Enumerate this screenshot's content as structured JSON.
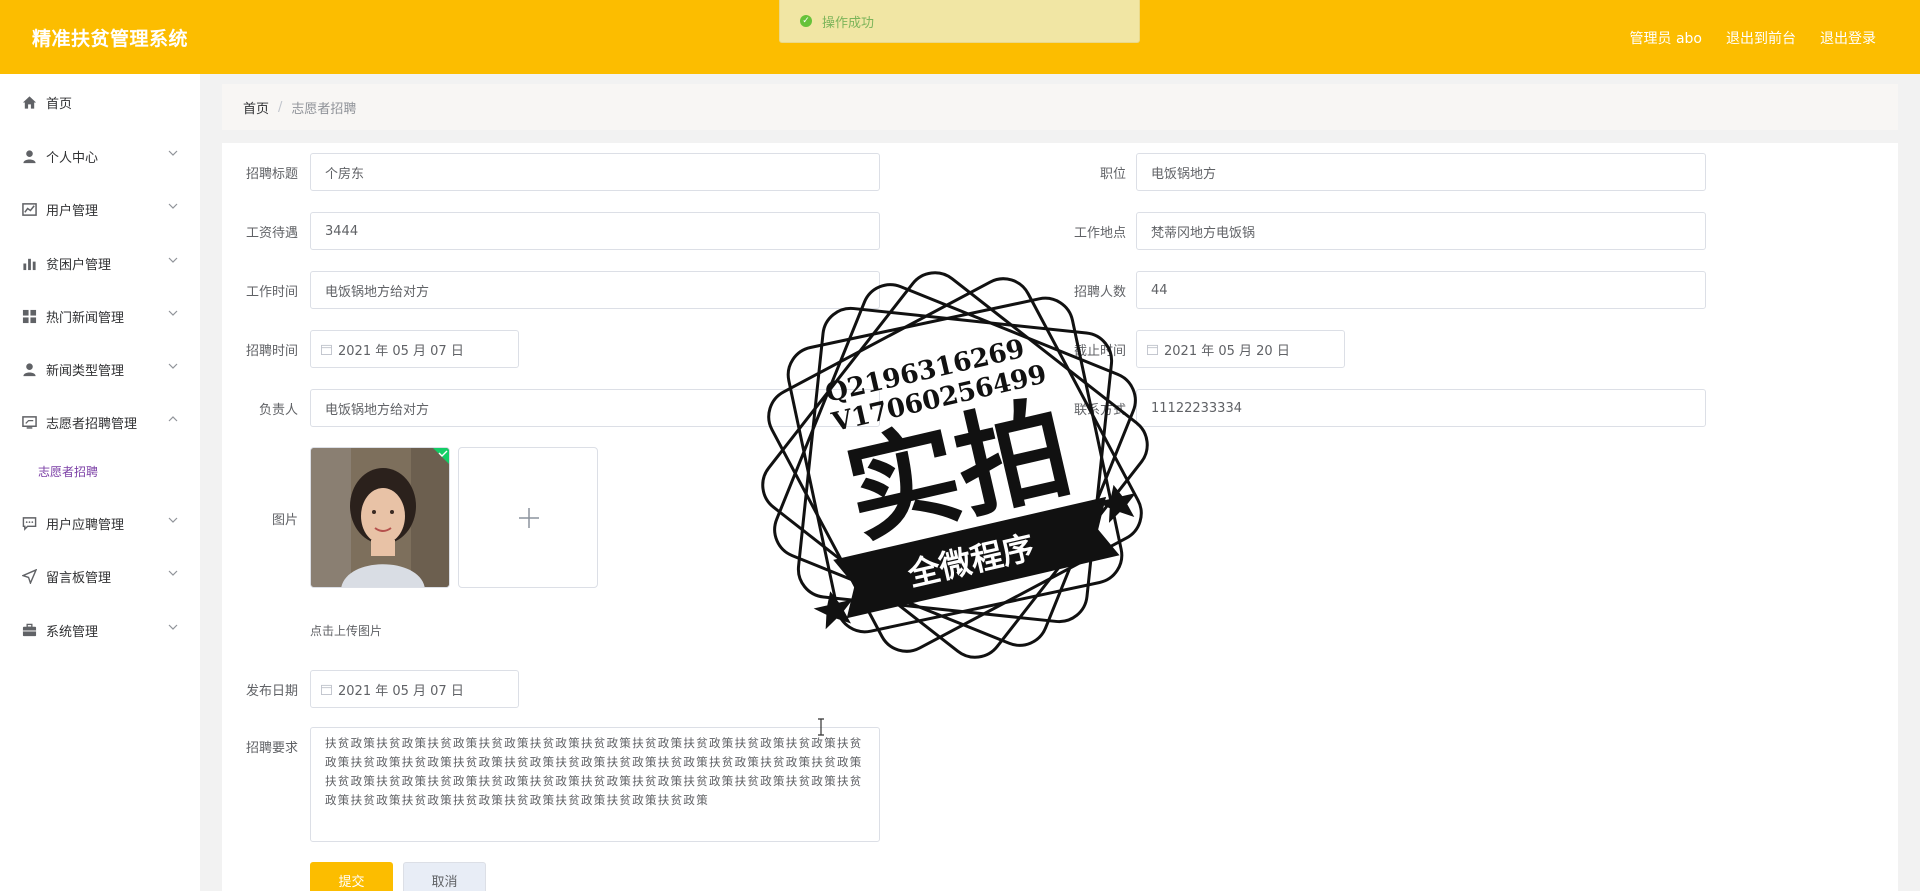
{
  "app": {
    "title": "精准扶贫管理系统"
  },
  "header": {
    "links": [
      "管理员 abo",
      "退出到前台",
      "退出登录"
    ]
  },
  "toast": {
    "text": "操作成功"
  },
  "sidebar": {
    "items": [
      {
        "label": "首页",
        "icon": "home-icon"
      },
      {
        "label": "个人中心",
        "icon": "user-icon"
      },
      {
        "label": "用户管理",
        "icon": "chart-icon"
      },
      {
        "label": "贫困户管理",
        "icon": "bar-chart-icon"
      },
      {
        "label": "热门新闻管理",
        "icon": "grid-icon"
      },
      {
        "label": "新闻类型管理",
        "icon": "user-icon"
      },
      {
        "label": "志愿者招聘管理",
        "icon": "monitor-icon"
      },
      {
        "label": "用户应聘管理",
        "icon": "chat-icon"
      },
      {
        "label": "留言板管理",
        "icon": "send-icon"
      },
      {
        "label": "系统管理",
        "icon": "briefcase-icon"
      }
    ],
    "submenu": {
      "label": "志愿者招聘"
    }
  },
  "breadcrumb": {
    "home": "首页",
    "separator": "/",
    "current": "志愿者招聘"
  },
  "form": {
    "title": {
      "label": "招聘标题",
      "value": "个房东"
    },
    "position": {
      "label": "职位",
      "value": "电饭锅地方"
    },
    "salary": {
      "label": "工资待遇",
      "value": "3444"
    },
    "location": {
      "label": "工作地点",
      "value": "梵蒂冈地方电饭锅"
    },
    "work_time": {
      "label": "工作时间",
      "value": "电饭锅地方给对方"
    },
    "headcount": {
      "label": "招聘人数",
      "value": "44"
    },
    "recruit_date": {
      "label": "招聘时间",
      "value": "2021 年 05 月 07 日"
    },
    "deadline": {
      "label": "截止时间",
      "value": "2021 年 05 月 20 日"
    },
    "manager": {
      "label": "负责人",
      "value": "电饭锅地方给对方"
    },
    "contact": {
      "label": "联系方式",
      "value": "11122233334"
    },
    "image": {
      "label": "图片",
      "hint": "点击上传图片"
    },
    "publish_date": {
      "label": "发布日期",
      "value": "2021 年 05 月 07 日"
    },
    "requirements": {
      "label": "招聘要求",
      "value": "扶贫政策扶贫政策扶贫政策扶贫政策扶贫政策扶贫政策扶贫政策扶贫政策扶贫政策扶贫政策扶贫政策扶贫政策扶贫政策扶贫政策扶贫政策扶贫政策扶贫政策扶贫政策扶贫政策扶贫政策扶贫政策扶贫政策扶贫政策扶贫政策扶贫政策扶贫政策扶贫政策扶贫政策扶贫政策扶贫政策扶贫政策扶贫政策扶贫政策扶贫政策扶贫政策扶贫政策扶贫政策扶贫政策扶贫政策"
    },
    "submit": "提交",
    "cancel": "取消"
  },
  "watermark": {
    "qq": "Q2196316269",
    "vx": "V17060256499",
    "big": "实拍",
    "ribbon": "全微程序"
  },
  "colors": {
    "accent": "#fcbd00",
    "success": "#67c23a"
  }
}
